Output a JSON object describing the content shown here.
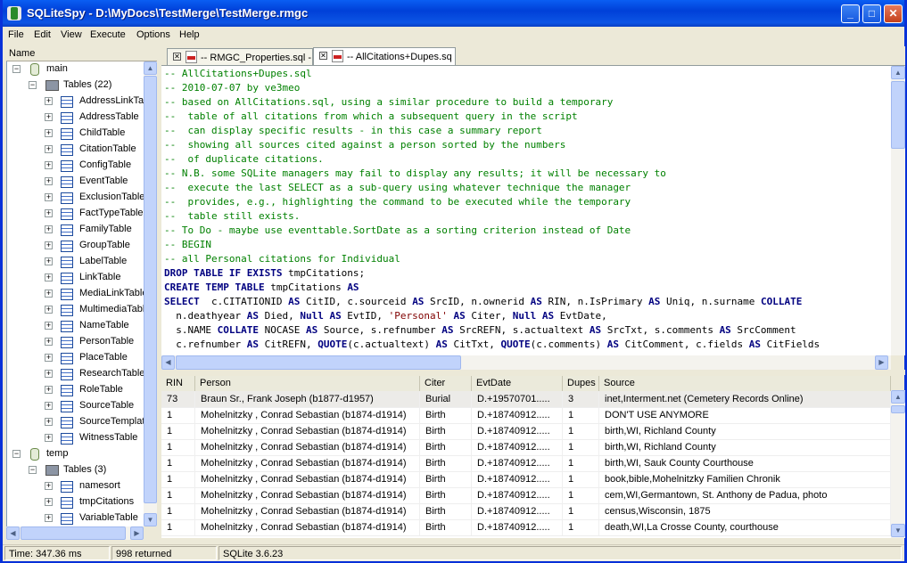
{
  "window": {
    "title": "SQLiteSpy - D:\\MyDocs\\TestMerge\\TestMerge.rmgc",
    "min": "_",
    "max": "□",
    "close": "✕"
  },
  "menu": [
    "File",
    "Edit",
    "View",
    "Execute",
    "Options",
    "Help"
  ],
  "tree": {
    "header": "Name",
    "main": {
      "label": "main",
      "tables_label": "Tables (22)",
      "tables": [
        "AddressLinkTa",
        "AddressTable",
        "ChildTable",
        "CitationTable",
        "ConfigTable",
        "EventTable",
        "ExclusionTable",
        "FactTypeTable",
        "FamilyTable",
        "GroupTable",
        "LabelTable",
        "LinkTable",
        "MediaLinkTable",
        "MultimediaTabl",
        "NameTable",
        "PersonTable",
        "PlaceTable",
        "ResearchTable",
        "RoleTable",
        "SourceTable",
        "SourceTemplat",
        "WitnessTable"
      ]
    },
    "temp": {
      "label": "temp",
      "tables_label": "Tables (3)",
      "tables": [
        "namesort",
        "tmpCitations",
        "VariableTable"
      ]
    }
  },
  "tabs": [
    "-- RMGC_Properties.sql -",
    "-- AllCitations+Dupes.sq"
  ],
  "editor": {
    "comments": [
      "-- AllCitations+Dupes.sql",
      "-- 2010-07-07 by ve3meo",
      "-- based on AllCitations.sql, using a similar procedure to build a temporary",
      "--  table of all citations from which a subsequent query in the script",
      "--  can display specific results - in this case a summary report",
      "--  showing all sources cited against a person sorted by the numbers",
      "--  of duplicate citations.",
      "-- N.B. some SQLite managers may fail to display any results; it will be necessary to",
      "--  execute the last SELECT as a sub-query using whatever technique the manager",
      "--  provides, e.g., highlighting the command to be executed while the temporary",
      "--  table still exists.",
      "-- To Do - maybe use eventtable.SortDate as a sorting criterion instead of Date",
      "-- BEGIN",
      "-- all Personal citations for Individual"
    ],
    "code": [
      [
        [
          "k",
          "DROP TABLE IF EXISTS"
        ],
        [
          "t",
          " tmpCitations;"
        ]
      ],
      [
        [
          "k",
          "CREATE TEMP TABLE"
        ],
        [
          "t",
          " tmpCitations "
        ],
        [
          "k",
          "AS"
        ]
      ],
      [
        [
          "k",
          "SELECT"
        ],
        [
          "t",
          "  c.CITATIONID "
        ],
        [
          "k",
          "AS"
        ],
        [
          "t",
          " CitID, c.sourceid "
        ],
        [
          "k",
          "AS"
        ],
        [
          "t",
          " SrcID, n.ownerid "
        ],
        [
          "k",
          "AS"
        ],
        [
          "t",
          " RIN, n.IsPrimary "
        ],
        [
          "k",
          "AS"
        ],
        [
          "t",
          " Uniq, n.surname "
        ],
        [
          "k",
          "COLLATE"
        ]
      ],
      [
        [
          "t",
          "  n.deathyear "
        ],
        [
          "k",
          "AS"
        ],
        [
          "t",
          " Died, "
        ],
        [
          "k",
          "Null AS"
        ],
        [
          "t",
          " EvtID, "
        ],
        [
          "s",
          "'Personal'"
        ],
        [
          "t",
          " "
        ],
        [
          "k",
          "AS"
        ],
        [
          "t",
          " Citer, "
        ],
        [
          "k",
          "Null AS"
        ],
        [
          "t",
          " EvtDate,"
        ]
      ],
      [
        [
          "t",
          "  s.NAME "
        ],
        [
          "k",
          "COLLATE"
        ],
        [
          "t",
          " NOCASE "
        ],
        [
          "k",
          "AS"
        ],
        [
          "t",
          " Source, s.refnumber "
        ],
        [
          "k",
          "AS"
        ],
        [
          "t",
          " SrcREFN, s.actualtext "
        ],
        [
          "k",
          "AS"
        ],
        [
          "t",
          " SrcTxt, s.comments "
        ],
        [
          "k",
          "AS"
        ],
        [
          "t",
          " SrcComment"
        ]
      ],
      [
        [
          "t",
          "  c.refnumber "
        ],
        [
          "k",
          "AS"
        ],
        [
          "t",
          " CitREFN, "
        ],
        [
          "k",
          "QUOTE"
        ],
        [
          "t",
          "(c.actualtext) "
        ],
        [
          "k",
          "AS"
        ],
        [
          "t",
          " CitTxt, "
        ],
        [
          "k",
          "QUOTE"
        ],
        [
          "t",
          "(c.comments) "
        ],
        [
          "k",
          "AS"
        ],
        [
          "t",
          " CitComment, c.fields "
        ],
        [
          "k",
          "AS"
        ],
        [
          "t",
          " CitFields"
        ]
      ]
    ]
  },
  "grid": {
    "columns": [
      "RIN",
      "Person",
      "Citer",
      "EvtDate",
      "Dupes",
      "Source"
    ],
    "rows": [
      [
        "73",
        "Braun Sr.,  Frank Joseph (b1877-d1957)",
        "Burial",
        "D.+19570701.....",
        "3",
        "inet,Interment.net (Cemetery Records Online)"
      ],
      [
        "1",
        "Mohelnitzky , Conrad Sebastian (b1874-d1914)",
        "Birth",
        "D.+18740912.....",
        "1",
        "DON'T USE ANYMORE"
      ],
      [
        "1",
        "Mohelnitzky , Conrad Sebastian (b1874-d1914)",
        "Birth",
        "D.+18740912.....",
        "1",
        "birth,WI, Richland County"
      ],
      [
        "1",
        "Mohelnitzky , Conrad Sebastian (b1874-d1914)",
        "Birth",
        "D.+18740912.....",
        "1",
        "birth,WI, Richland County"
      ],
      [
        "1",
        "Mohelnitzky , Conrad Sebastian (b1874-d1914)",
        "Birth",
        "D.+18740912.....",
        "1",
        "birth,WI, Sauk County Courthouse"
      ],
      [
        "1",
        "Mohelnitzky , Conrad Sebastian (b1874-d1914)",
        "Birth",
        "D.+18740912.....",
        "1",
        "book,bible,Mohelnitzky Familien Chronik"
      ],
      [
        "1",
        "Mohelnitzky , Conrad Sebastian (b1874-d1914)",
        "Birth",
        "D.+18740912.....",
        "1",
        "cem,WI,Germantown, St. Anthony de Padua, photo"
      ],
      [
        "1",
        "Mohelnitzky , Conrad Sebastian (b1874-d1914)",
        "Birth",
        "D.+18740912.....",
        "1",
        "census,Wisconsin, 1875"
      ],
      [
        "1",
        "Mohelnitzky , Conrad Sebastian (b1874-d1914)",
        "Birth",
        "D.+18740912.....",
        "1",
        "death,WI,La Crosse County, courthouse"
      ]
    ]
  },
  "status": {
    "time": "Time: 347.36 ms",
    "returned": "998 returned",
    "version": "SQLite 3.6.23"
  },
  "colors": {
    "comment": "#008000",
    "keyword": "#000080",
    "string": "#800000"
  }
}
